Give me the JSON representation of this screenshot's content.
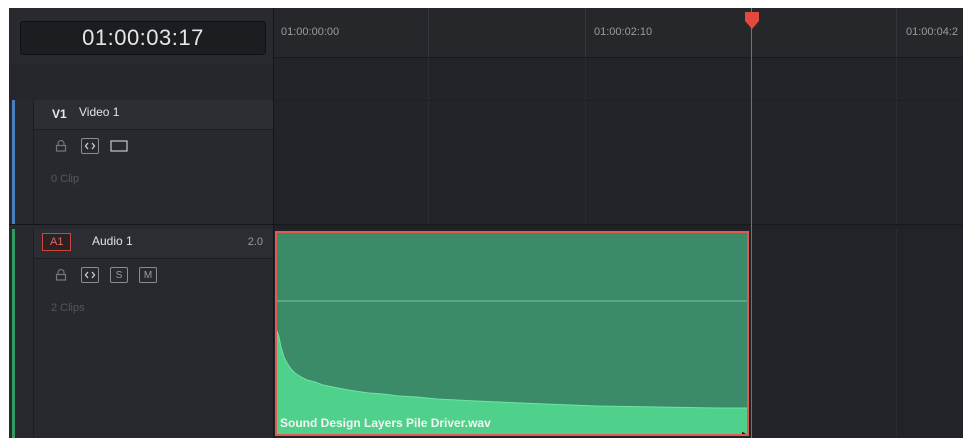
{
  "timecode": "01:00:03:17",
  "ruler": {
    "labels": [
      "01:00:00:00",
      "01:00:02:10",
      "01:00:04:2"
    ]
  },
  "tracks": {
    "video": {
      "id": "V1",
      "name": "Video 1",
      "clip_count": "0 Clip",
      "color": "#4a7dbb"
    },
    "audio": {
      "id": "A1",
      "name": "Audio 1",
      "channels": "2.0",
      "solo_label": "S",
      "mute_label": "M",
      "clip_count": "2 Clips",
      "color": "#2f9b63"
    }
  },
  "clip": {
    "name": "Sound Design Layers Pile Driver.wav",
    "color": "#3b8a68",
    "selected_border": "#e15a4f"
  },
  "playhead": {
    "color": "#d94a3e"
  },
  "icons": [
    "lock-icon",
    "auto-select-icon",
    "display-toggle-icon",
    "curve-icon",
    "playhead-icon"
  ]
}
